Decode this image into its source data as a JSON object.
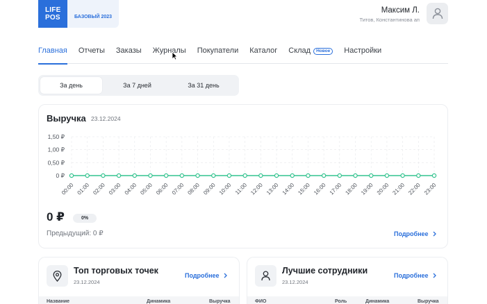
{
  "header": {
    "logo_line1": "LIFE",
    "logo_line2": "POS",
    "logo_tag": "БАЗОВЫЙ 2023",
    "user_name": "Максим Л.",
    "user_org": "Титов, Константинова ап",
    "brand_color": "#2a6fdb"
  },
  "nav": {
    "items": [
      {
        "label": "Главная",
        "active": true
      },
      {
        "label": "Отчеты"
      },
      {
        "label": "Заказы"
      },
      {
        "label": "Журналы"
      },
      {
        "label": "Покупатели"
      },
      {
        "label": "Каталог"
      },
      {
        "label": "Склад",
        "badge": "Новое"
      },
      {
        "label": "Настройки"
      }
    ]
  },
  "period": {
    "options": [
      "За день",
      "За 7 дней",
      "За 31 день"
    ],
    "selected": "За день"
  },
  "revenue": {
    "title": "Выручка",
    "date": "23.12.2024",
    "value": "0 ₽",
    "change": "0%",
    "previous": "Предыдущий: 0 ₽",
    "more": "Подробнее"
  },
  "chart_data": {
    "type": "line",
    "x": [
      "00:00",
      "01:00",
      "02:00",
      "03:00",
      "04:00",
      "05:00",
      "06:00",
      "07:00",
      "08:00",
      "09:00",
      "10:00",
      "11:00",
      "12:00",
      "13:00",
      "14:00",
      "15:00",
      "16:00",
      "17:00",
      "18:00",
      "19:00",
      "20:00",
      "21:00",
      "22:00",
      "23:00"
    ],
    "series": [
      {
        "values": [
          0,
          0,
          0,
          0,
          0,
          0,
          0,
          0,
          0,
          0,
          0,
          0,
          0,
          0,
          0,
          0,
          0,
          0,
          0,
          0,
          0,
          0,
          0,
          0
        ],
        "color": "#34c38f"
      }
    ],
    "y_ticks": [
      {
        "value": 0,
        "label": "0 ₽"
      },
      {
        "value": 0.5,
        "label": "0,50 ₽"
      },
      {
        "value": 1.0,
        "label": "1,00 ₽"
      },
      {
        "value": 1.5,
        "label": "1,50 ₽"
      }
    ],
    "ylim": [
      0,
      1.5
    ],
    "grid": "dashed",
    "title": "",
    "xlabel": "",
    "ylabel": ""
  },
  "top_points": {
    "title": "Топ торговых точек",
    "date": "23.12.2024",
    "more": "Подробнее",
    "columns": [
      "Название",
      "Динамика",
      "Выручка"
    ],
    "icon": "map-pin-icon"
  },
  "best_employees": {
    "title": "Лучшие сотрудники",
    "date": "23.12.2024",
    "more": "Подробнее",
    "columns": [
      "ФИО",
      "Роль",
      "Динамика",
      "Выручка"
    ],
    "icon": "user-icon"
  }
}
